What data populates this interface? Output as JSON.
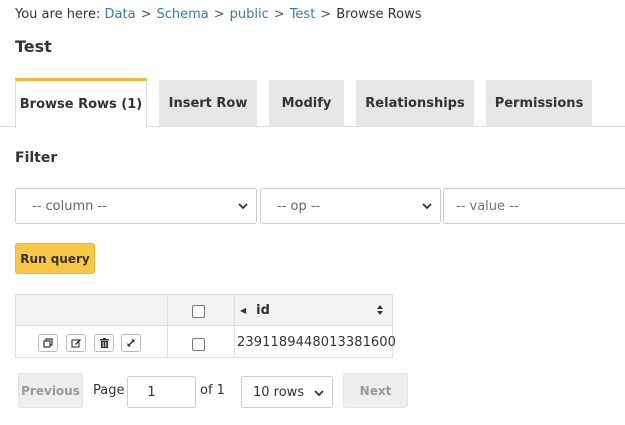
{
  "breadcrumb": {
    "prefix": "You are here:",
    "links": [
      "Data",
      "Schema",
      "public",
      "Test"
    ],
    "current": "Browse Rows",
    "separator": ">"
  },
  "page_title": "Test",
  "tabs": [
    {
      "label": "Browse Rows (1)",
      "active": true
    },
    {
      "label": "Insert Row",
      "active": false
    },
    {
      "label": "Modify",
      "active": false
    },
    {
      "label": "Relationships",
      "active": false
    },
    {
      "label": "Permissions",
      "active": false
    }
  ],
  "filter": {
    "heading": "Filter",
    "column_select": "-- column --",
    "op_select": "-- op --",
    "value_placeholder": "-- value --",
    "run_label": "Run query"
  },
  "grid": {
    "columns": [
      "id"
    ],
    "rows": [
      {
        "id": "2391189448013381600",
        "checked": false
      }
    ],
    "header_checked": false
  },
  "pagination": {
    "previous_label": "Previous",
    "page_label": "Page",
    "page_value": "1",
    "of_label": "of 1",
    "rows_select": "10 rows",
    "next_label": "Next"
  },
  "colors": {
    "accent": "#f2b83f",
    "run_button": "#f8c845",
    "link": "#337ab7"
  }
}
